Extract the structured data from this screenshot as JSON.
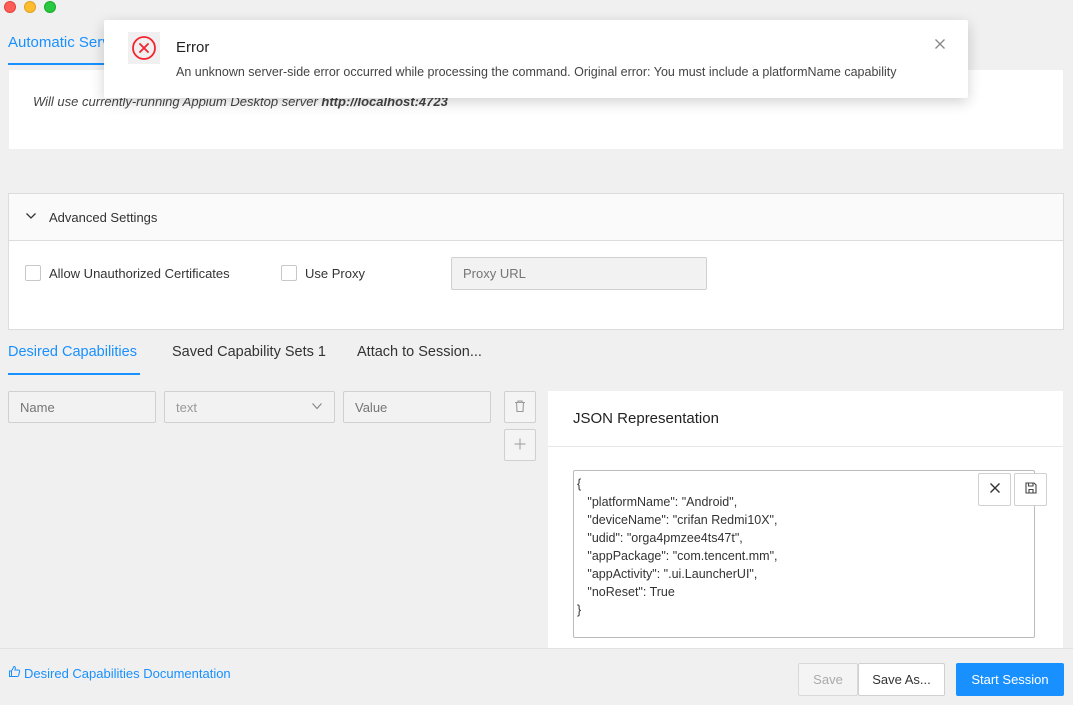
{
  "window": {
    "controls": [
      "close",
      "minimize",
      "zoom"
    ]
  },
  "server": {
    "tab_label": "Automatic Serv",
    "info_prefix": "Will use currently-running Appium Desktop server ",
    "info_url": "http://localhost:4723"
  },
  "notification": {
    "title": "Error",
    "message": "An unknown server-side error occurred while processing the command. Original error: You must include a platformName capability",
    "icon": "error-circle-icon",
    "accent_color": "#f5222d"
  },
  "advanced": {
    "title": "Advanced Settings",
    "allow_unauthorized_label": "Allow Unauthorized Certificates",
    "use_proxy_label": "Use Proxy",
    "proxy_placeholder": "Proxy URL"
  },
  "cap_tabs": [
    {
      "label": "Desired Capabilities",
      "active": true
    },
    {
      "label": "Saved Capability Sets 1",
      "active": false
    },
    {
      "label": "Attach to Session...",
      "active": false
    }
  ],
  "cap_row": {
    "name_placeholder": "Name",
    "type_value": "text",
    "value_placeholder": "Value"
  },
  "json": {
    "title": "JSON Representation",
    "lines": [
      "{",
      "   \"platformName\": \"Android\",",
      "   \"deviceName\": \"crifan Redmi10X\",",
      "   \"udid\": \"orga4pmzee4ts47t\",",
      "   \"appPackage\": \"com.tencent.mm\",",
      "   \"appActivity\": \".ui.LauncherUI\",",
      "   \"noReset\": True",
      "}"
    ]
  },
  "footer": {
    "doc_link": "Desired Capabilities Documentation",
    "save_label": "Save",
    "save_as_label": "Save As...",
    "start_label": "Start Session"
  },
  "colors": {
    "accent": "#1890ff",
    "error": "#f5222d"
  }
}
